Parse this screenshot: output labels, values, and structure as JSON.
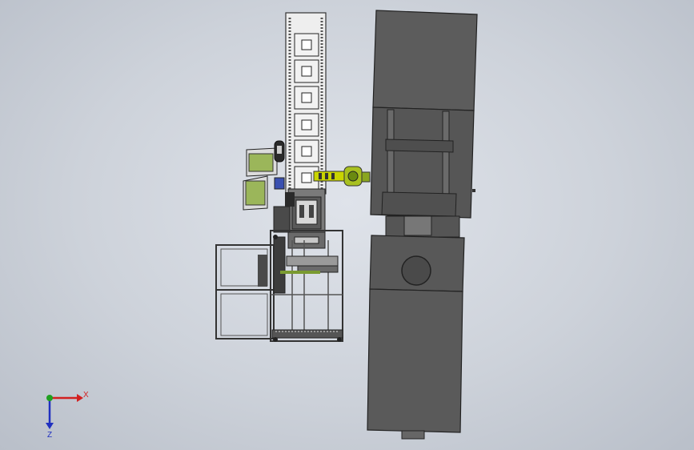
{
  "viewport": {
    "background_top": "#dfe3ea",
    "background_bottom": "#b9bfc9"
  },
  "model": {
    "machine_body_color": "#5a5a5a",
    "frame_color": "#3a3a3a",
    "conveyor_color": "#e9e9e9",
    "tray_count": 6,
    "robot_arm_color": "#c8d400",
    "panel_color": "#9bb65a"
  },
  "triad": {
    "x_label": "X",
    "z_label": "Z",
    "x_color": "#d22020",
    "y_color": "#20a020",
    "z_color": "#2030c0"
  }
}
